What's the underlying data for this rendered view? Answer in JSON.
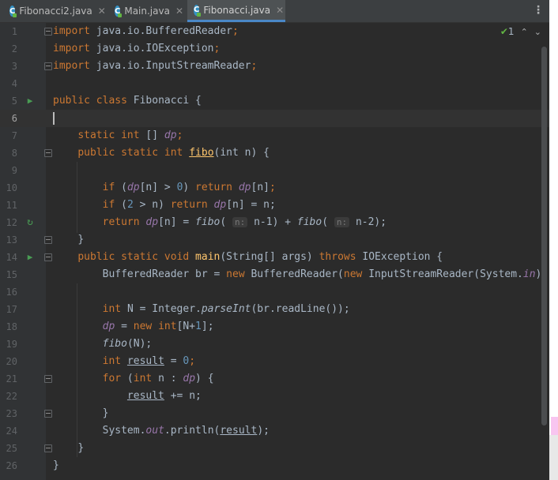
{
  "tabs": [
    {
      "label": "Fibonacci2.java",
      "icon": "java-class-icon",
      "active": false
    },
    {
      "label": "Main.java",
      "icon": "java-class-icon",
      "active": false
    },
    {
      "label": "Fibonacci.java",
      "icon": "java-class-icon",
      "active": true
    }
  ],
  "tab_icon_letter": "C",
  "tab_close": "✕",
  "menu_glyph": "⋮",
  "inspection": {
    "check": "✔",
    "count": "1",
    "up": "⌃",
    "down": "⌄"
  },
  "colors": {
    "background": "#2b2b2b",
    "gutter": "#313335",
    "keyword": "#cc7832",
    "number": "#6897bb",
    "field": "#9876aa",
    "function": "#ffc66d",
    "text": "#a9b7c6",
    "run": "#499c54"
  },
  "line_numbers": [
    "1",
    "2",
    "3",
    "4",
    "5",
    "6",
    "7",
    "8",
    "9",
    "10",
    "11",
    "12",
    "13",
    "14",
    "15",
    "16",
    "17",
    "18",
    "19",
    "20",
    "21",
    "22",
    "23",
    "24",
    "25",
    "26"
  ],
  "code": {
    "imp": "import",
    "l1": "java.io.BufferedReader",
    "l2": "java.io.IOException",
    "l3": "java.io.InputStreamReader",
    "semi": ";",
    "public": "public",
    "class": "class",
    "static": "static",
    "int": "int",
    "void": "void",
    "new": "new",
    "if": "if",
    "return": "return",
    "for": "for",
    "throws": "throws",
    "cls_name": "Fibonacci",
    "open": " {",
    "close": "}",
    "arr": " [] ",
    "dp": "dp",
    "fibo": "fibo",
    "n_param": "(int n) {",
    "n": "n",
    "lb": "[",
    "rb": "]",
    "gt": " > ",
    "zero": "0",
    "one": "1",
    "two": "2",
    "paren_open": "(",
    "paren_close": ")",
    "hint_n": "n:",
    "main": "main",
    "main_args": "(String[] args) ",
    "ioexc": "IOException",
    "br_decl": "BufferedReader br = ",
    "br_new": "BufferedReader(",
    "isr": "InputStreamReader(System.",
    "in": "in",
    "close2": "));",
    "int_N": "N = Integer.",
    "parseInt": "parseInt",
    "readLine": "(br.readLine());",
    "dp_assign": " = ",
    "new_arr": "[N+",
    "arr_end": "];",
    "fiboN": "(N);",
    "result": "result",
    "eq": " = ",
    "for_open": " (",
    "colon": " : ",
    "for_end": ") {",
    "plus_eq": " += n;",
    "sys_out": "System.",
    "out": "out",
    "println": ".println(",
    "println_end": ");",
    "minus1": "n-1",
    "minus2": "n-2",
    "ret_close": ");",
    "plus": " + ",
    "eq_n": " = n;",
    "dp_n_eq": "[n] = "
  }
}
